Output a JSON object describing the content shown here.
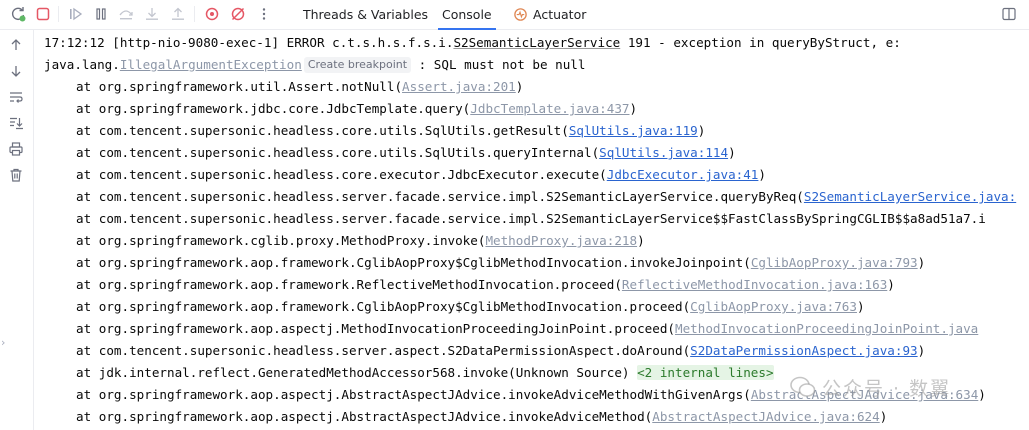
{
  "tabs": [
    {
      "label": "Threads & Variables"
    },
    {
      "label": "Console"
    },
    {
      "label": "Actuator"
    }
  ],
  "console": {
    "line1": "17:12:12 [http-nio-9080-exec-1] ERROR c.t.s.h.s.f.s.i.",
    "line1_class": "S2SemanticLayerService",
    "line1_rest": " 191 - exception in queryByStruct, e:",
    "line2_prefix": "java.lang.",
    "line2_exception": "IllegalArgumentException",
    "create_breakpoint": "Create breakpoint",
    "line2_msg": " : SQL must not be null",
    "frames": [
      {
        "text": "at org.springframework.util.Assert.notNull(",
        "link": "Assert.java:201",
        "suffix": ")",
        "muted": true
      },
      {
        "text": "at org.springframework.jdbc.core.JdbcTemplate.query(",
        "link": "JdbcTemplate.java:437",
        "suffix": ")",
        "muted": true
      },
      {
        "text": "at com.tencent.supersonic.headless.core.utils.SqlUtils.getResult(",
        "link": "SqlUtils.java:119",
        "suffix": ")",
        "muted": false
      },
      {
        "text": "at com.tencent.supersonic.headless.core.utils.SqlUtils.queryInternal(",
        "link": "SqlUtils.java:114",
        "suffix": ")",
        "muted": false
      },
      {
        "text": "at com.tencent.supersonic.headless.core.executor.JdbcExecutor.execute(",
        "link": "JdbcExecutor.java:41",
        "suffix": ")",
        "muted": false
      },
      {
        "text": "at com.tencent.supersonic.headless.server.facade.service.impl.S2SemanticLayerService.queryByReq(",
        "link": "S2SemanticLayerService.java:",
        "suffix": "",
        "muted": false
      },
      {
        "text": "at com.tencent.supersonic.headless.server.facade.service.impl.S2SemanticLayerService$$FastClassBySpringCGLIB$$a8ad51a7.i",
        "link": "",
        "suffix": "",
        "muted": false
      },
      {
        "text": "at org.springframework.cglib.proxy.MethodProxy.invoke(",
        "link": "MethodProxy.java:218",
        "suffix": ")",
        "muted": true
      },
      {
        "text": "at org.springframework.aop.framework.CglibAopProxy$CglibMethodInvocation.invokeJoinpoint(",
        "link": "CglibAopProxy.java:793",
        "suffix": ")",
        "muted": true
      },
      {
        "text": "at org.springframework.aop.framework.ReflectiveMethodInvocation.proceed(",
        "link": "ReflectiveMethodInvocation.java:163",
        "suffix": ")",
        "muted": true
      },
      {
        "text": "at org.springframework.aop.framework.CglibAopProxy$CglibMethodInvocation.proceed(",
        "link": "CglibAopProxy.java:763",
        "suffix": ")",
        "muted": true
      },
      {
        "text": "at org.springframework.aop.aspectj.MethodInvocationProceedingJoinPoint.proceed(",
        "link": "MethodInvocationProceedingJoinPoint.java",
        "suffix": "",
        "muted": true
      },
      {
        "text": "at com.tencent.supersonic.headless.server.aspect.S2DataPermissionAspect.doAround(",
        "link": "S2DataPermissionAspect.java:93",
        "suffix": ")",
        "muted": false
      },
      {
        "text": "at jdk.internal.reflect.GeneratedMethodAccessor568.invoke(Unknown Source) ",
        "link": "",
        "folded": "<2 internal lines>",
        "suffix": "",
        "muted": false
      },
      {
        "text": "at org.springframework.aop.aspectj.AbstractAspectJAdvice.invokeAdviceMethodWithGivenArgs(",
        "link": "AbstractAspectJAdvice.java:634",
        "suffix": ")",
        "muted": true
      },
      {
        "text": "at org.springframework.aop.aspectj.AbstractAspectJAdvice.invokeAdviceMethod(",
        "link": "AbstractAspectJAdvice.java:624",
        "suffix": ")",
        "muted": true
      }
    ]
  },
  "watermark": "公众号 · 数翼",
  "icons": {
    "rerun": "rerun-icon",
    "stop": "stop-icon",
    "resume": "resume-icon",
    "pause": "pause-icon",
    "step-over": "step-over-icon",
    "step-into": "step-into-icon",
    "step-out": "step-out-icon",
    "breakpoints": "view-breakpoints-icon",
    "mute": "mute-breakpoints-icon",
    "more": "more-icon",
    "actuator": "actuator-icon",
    "layout": "layout-icon",
    "up": "arrow-up-icon",
    "down": "arrow-down-icon",
    "wrap": "soft-wrap-icon",
    "scroll-end": "scroll-to-end-icon",
    "print": "print-icon",
    "clear": "trash-icon"
  },
  "colors": {
    "link": "#2a64cf",
    "link_muted": "#8d97a8",
    "tab_underline": "#3574f0",
    "error_stop": "#e55765"
  }
}
